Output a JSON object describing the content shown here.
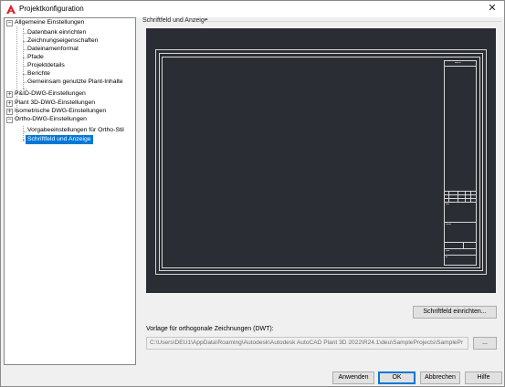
{
  "window": {
    "title": "Projektkonfiguration",
    "close_glyph": "✕",
    "brand_color": "#e11b22"
  },
  "tree": {
    "nodes": [
      {
        "label": "Allgemeine Einstellungen",
        "expander": "−"
      },
      {
        "label": "Datenbank einrichten"
      },
      {
        "label": "Zeichnungseigenschaften"
      },
      {
        "label": "Dateinamenformat"
      },
      {
        "label": "Pfade"
      },
      {
        "label": "Projektdetails"
      },
      {
        "label": "Berichte"
      },
      {
        "label": "Gemeinsam genutzte Plant-Inhalte"
      },
      {
        "label": "P&ID-DWG-Einstellungen",
        "expander": "+"
      },
      {
        "label": "Plant 3D-DWG-Einstellungen",
        "expander": "+"
      },
      {
        "label": "Isometrische DWG-Einstellungen",
        "expander": "+"
      },
      {
        "label": "Ortho-DWG-Einstellungen",
        "expander": "−"
      },
      {
        "label": "Vorgabeeinstellungen für Ortho-Stil"
      },
      {
        "label": "Schriftfeld und Anzeige",
        "selected": true
      }
    ]
  },
  "main": {
    "section_title": "Schriftfeld und Anzeige",
    "setup_button": "Schriftfeld einrichten...",
    "template_label": "Vorlage für orthogonale Zeichnungen (DWT):",
    "template_path": "C:\\Users\\DEU1\\AppData\\Roaming\\Autodesk\\Autodesk AutoCAD Plant 3D 2022\\R24.1\\deu\\SampleProjects\\SamplePr",
    "browse_button": "..."
  },
  "footer": {
    "apply": "Anwenden",
    "ok": "OK",
    "cancel": "Abbrechen",
    "help": "Hilfe"
  }
}
